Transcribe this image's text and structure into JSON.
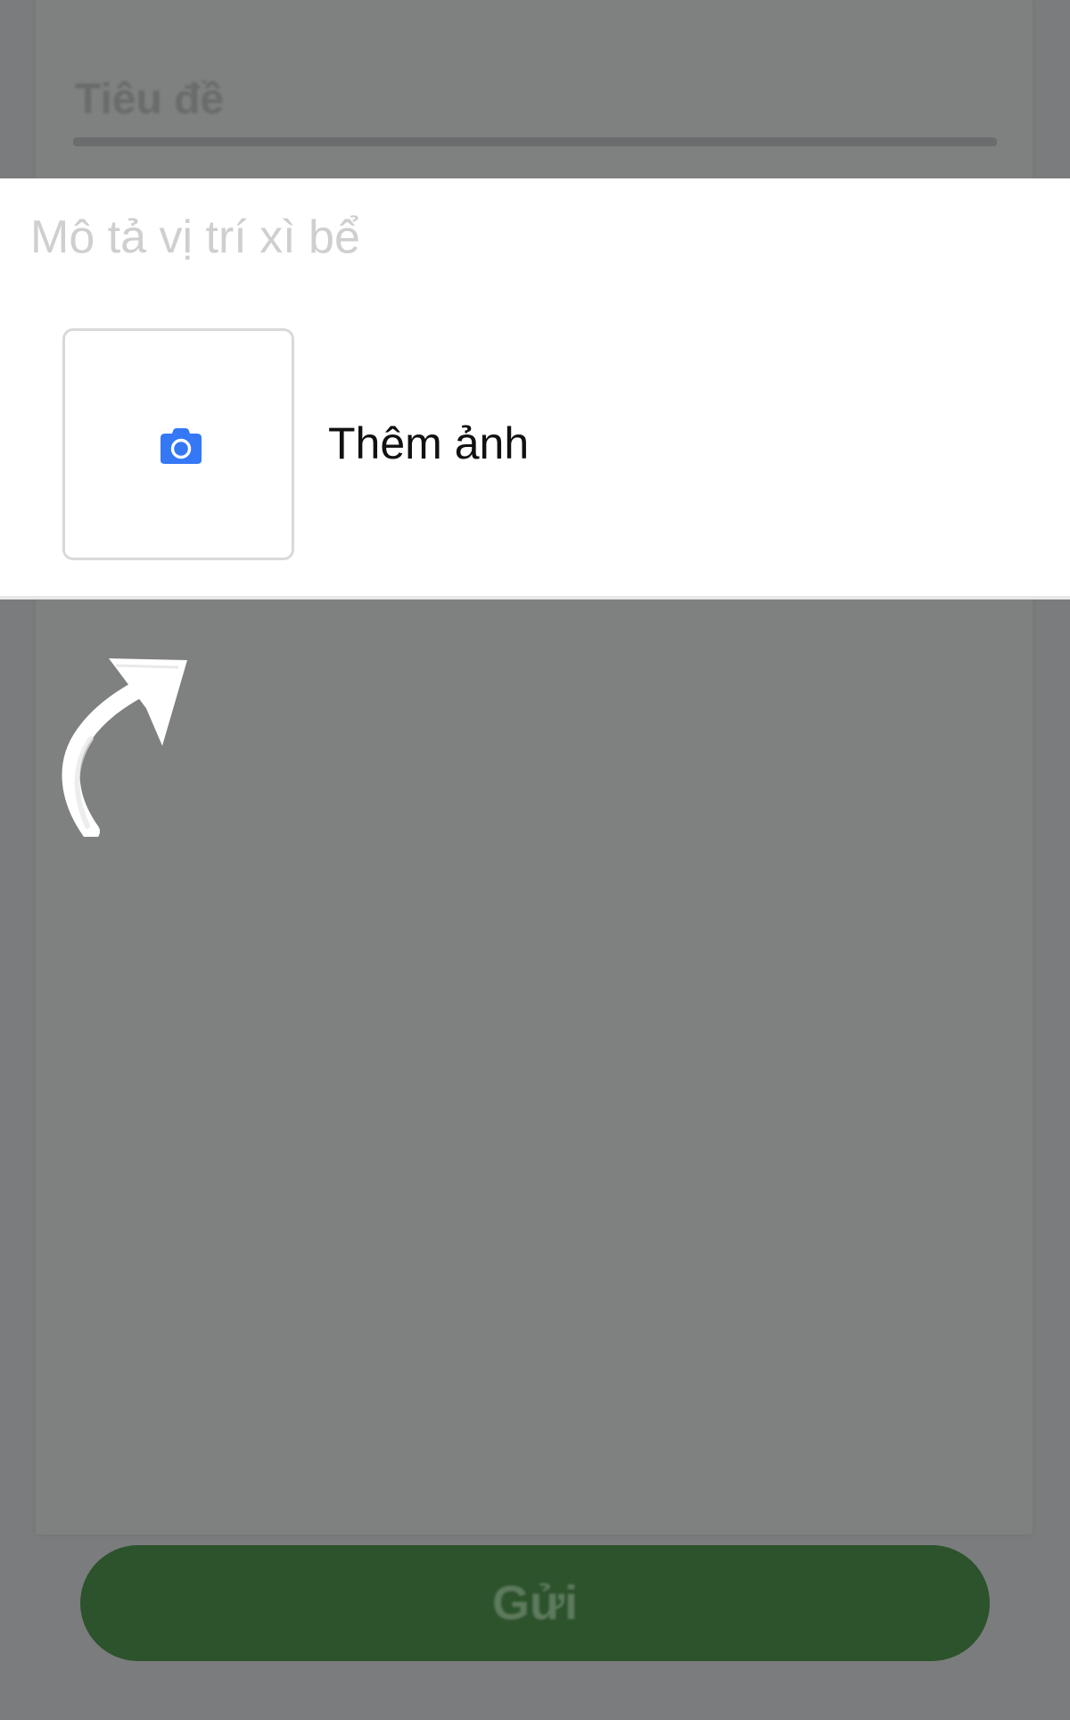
{
  "form": {
    "title_placeholder": "Tiêu đề",
    "description_placeholder": "Mô tả vị trí xì bể",
    "add_photo_label": "Thêm ảnh",
    "submit_label": "Gửi"
  },
  "icons": {
    "camera": "camera-icon",
    "arrow": "curved-arrow-icon"
  },
  "colors": {
    "overlay": "#7b7c7d",
    "accent_blue": "#3478f6",
    "submit_green": "#2c532c",
    "highlight_background": "#ffffff"
  }
}
